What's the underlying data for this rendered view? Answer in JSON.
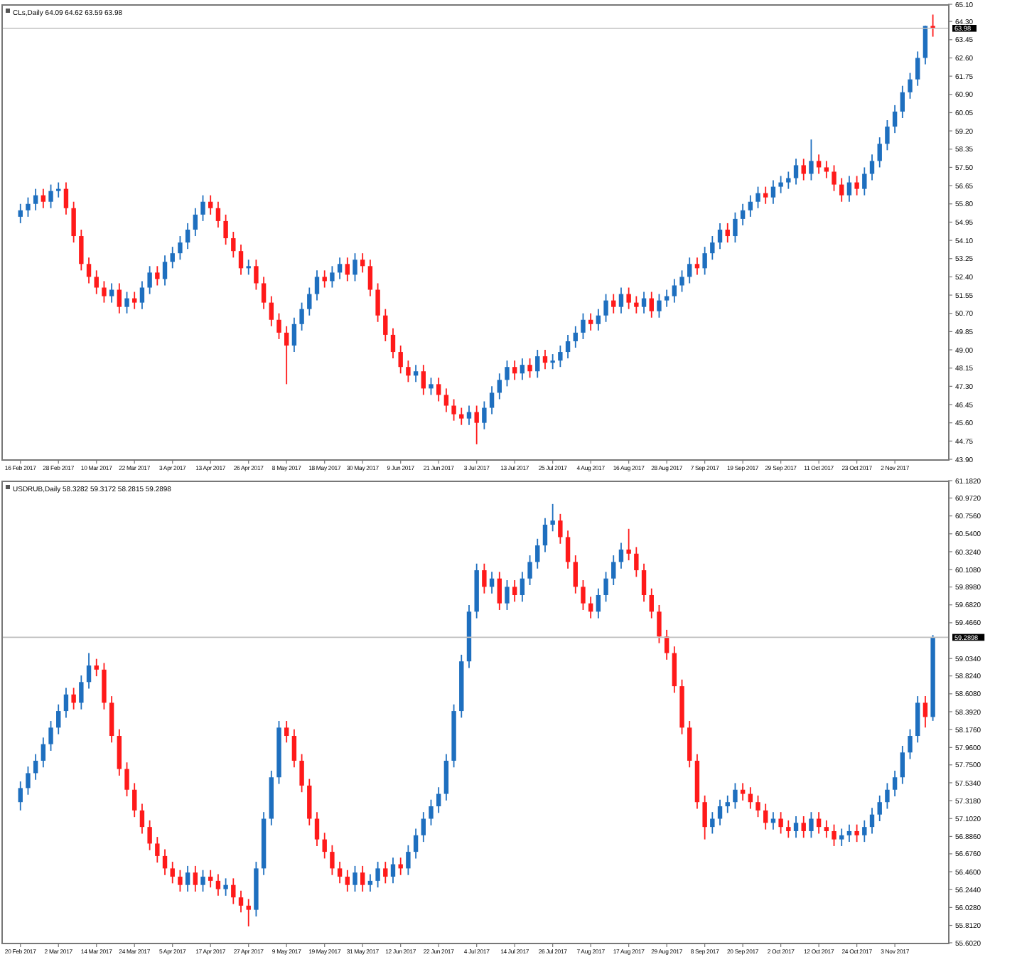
{
  "charts": [
    {
      "title": "CLs,Daily 64.09 64.62 63.59 63.98",
      "chart_data": {
        "type": "candlestick",
        "ylim": [
          43.9,
          65.1
        ],
        "ref_lines": [
          {
            "axis": "y",
            "value": 63.98,
            "label": "63.98"
          }
        ],
        "categories": [
          "16 Feb 2017",
          null,
          null,
          null,
          null,
          "28 Feb 2017",
          null,
          null,
          null,
          null,
          "10 Mar 2017",
          null,
          null,
          null,
          null,
          "22 Mar 2017",
          null,
          null,
          null,
          null,
          "3 Apr 2017",
          null,
          null,
          null,
          null,
          "13 Apr 2017",
          null,
          null,
          null,
          null,
          "26 Apr 2017",
          null,
          null,
          null,
          null,
          "8 May 2017",
          null,
          null,
          null,
          null,
          "18 May 2017",
          null,
          null,
          null,
          null,
          "30 May 2017",
          null,
          null,
          null,
          null,
          "9 Jun 2017",
          null,
          null,
          null,
          null,
          "21 Jun 2017",
          null,
          null,
          null,
          null,
          "3 Jul 2017",
          null,
          null,
          null,
          null,
          "13 Jul 2017",
          null,
          null,
          null,
          null,
          "25 Jul 2017",
          null,
          null,
          null,
          null,
          "4 Aug 2017",
          null,
          null,
          null,
          null,
          "16 Aug 2017",
          null,
          null,
          null,
          null,
          "28 Aug 2017",
          null,
          null,
          null,
          null,
          "7 Sep 2017",
          null,
          null,
          null,
          null,
          "19 Sep 2017",
          null,
          null,
          null,
          null,
          "29 Sep 2017",
          null,
          null,
          null,
          null,
          "11 Oct 2017",
          null,
          null,
          null,
          null,
          "23 Oct 2017",
          null,
          null,
          null,
          null,
          "2 Nov 2017",
          null,
          null,
          null,
          null,
          null
        ],
        "ohlc": [
          [
            55.2,
            55.8,
            54.9,
            55.5
          ],
          [
            55.5,
            56.1,
            55.2,
            55.8
          ],
          [
            55.8,
            56.5,
            55.5,
            56.2
          ],
          [
            56.2,
            56.5,
            55.6,
            55.9
          ],
          [
            55.9,
            56.7,
            55.6,
            56.4
          ],
          [
            56.4,
            56.8,
            56.1,
            56.5
          ],
          [
            56.5,
            56.8,
            55.3,
            55.6
          ],
          [
            55.6,
            55.9,
            54.0,
            54.3
          ],
          [
            54.3,
            54.6,
            52.7,
            53.0
          ],
          [
            53.0,
            53.3,
            52.1,
            52.4
          ],
          [
            52.4,
            52.7,
            51.6,
            51.9
          ],
          [
            51.9,
            52.2,
            51.2,
            51.5
          ],
          [
            51.5,
            52.1,
            51.2,
            51.8
          ],
          [
            51.8,
            52.1,
            50.7,
            51.0
          ],
          [
            51.0,
            51.7,
            50.7,
            51.4
          ],
          [
            51.4,
            51.7,
            50.9,
            51.2
          ],
          [
            51.2,
            52.2,
            50.9,
            51.9
          ],
          [
            51.9,
            52.9,
            51.6,
            52.6
          ],
          [
            52.6,
            52.9,
            52.0,
            52.3
          ],
          [
            52.3,
            53.4,
            52.0,
            53.1
          ],
          [
            53.1,
            53.8,
            52.8,
            53.5
          ],
          [
            53.5,
            54.3,
            53.2,
            54.0
          ],
          [
            54.0,
            54.9,
            53.7,
            54.6
          ],
          [
            54.6,
            55.6,
            54.3,
            55.3
          ],
          [
            55.3,
            56.2,
            55.0,
            55.9
          ],
          [
            55.9,
            56.2,
            55.3,
            55.6
          ],
          [
            55.6,
            55.9,
            54.7,
            55.0
          ],
          [
            55.0,
            55.3,
            53.9,
            54.2
          ],
          [
            54.2,
            54.5,
            53.3,
            53.6
          ],
          [
            53.6,
            53.9,
            52.5,
            52.8
          ],
          [
            52.8,
            53.2,
            52.5,
            52.9
          ],
          [
            52.9,
            53.2,
            51.8,
            52.1
          ],
          [
            52.1,
            52.4,
            50.9,
            51.2
          ],
          [
            51.2,
            51.5,
            50.1,
            50.4
          ],
          [
            50.4,
            50.7,
            49.5,
            49.8
          ],
          [
            49.8,
            50.1,
            47.4,
            49.2
          ],
          [
            49.2,
            50.5,
            48.9,
            50.2
          ],
          [
            50.2,
            51.2,
            49.9,
            50.9
          ],
          [
            50.9,
            51.9,
            50.6,
            51.6
          ],
          [
            51.6,
            52.7,
            51.3,
            52.4
          ],
          [
            52.4,
            52.7,
            51.9,
            52.2
          ],
          [
            52.2,
            52.9,
            51.9,
            52.6
          ],
          [
            52.6,
            53.3,
            52.3,
            53.0
          ],
          [
            53.0,
            53.3,
            52.2,
            52.5
          ],
          [
            52.5,
            53.5,
            52.2,
            53.2
          ],
          [
            53.2,
            53.5,
            52.6,
            52.9
          ],
          [
            52.9,
            53.2,
            51.5,
            51.8
          ],
          [
            51.8,
            52.1,
            50.3,
            50.6
          ],
          [
            50.6,
            50.9,
            49.4,
            49.7
          ],
          [
            49.7,
            50.0,
            48.6,
            48.9
          ],
          [
            48.9,
            49.2,
            47.9,
            48.2
          ],
          [
            48.2,
            48.5,
            47.5,
            47.8
          ],
          [
            47.8,
            48.3,
            47.5,
            48.0
          ],
          [
            48.0,
            48.3,
            46.9,
            47.2
          ],
          [
            47.2,
            47.7,
            46.9,
            47.4
          ],
          [
            47.4,
            47.7,
            46.6,
            46.9
          ],
          [
            46.9,
            47.2,
            46.1,
            46.4
          ],
          [
            46.4,
            46.7,
            45.7,
            46.0
          ],
          [
            46.0,
            46.3,
            45.5,
            45.8
          ],
          [
            45.8,
            46.4,
            45.5,
            46.1
          ],
          [
            46.1,
            46.4,
            44.6,
            45.6
          ],
          [
            45.6,
            46.6,
            45.3,
            46.3
          ],
          [
            46.3,
            47.3,
            46.0,
            47.0
          ],
          [
            47.0,
            47.9,
            46.7,
            47.6
          ],
          [
            47.6,
            48.5,
            47.3,
            48.2
          ],
          [
            48.2,
            48.5,
            47.6,
            47.9
          ],
          [
            47.9,
            48.6,
            47.6,
            48.3
          ],
          [
            48.3,
            48.6,
            47.7,
            48.0
          ],
          [
            48.0,
            49.0,
            47.7,
            48.7
          ],
          [
            48.7,
            49.0,
            48.1,
            48.4
          ],
          [
            48.4,
            48.8,
            48.1,
            48.5
          ],
          [
            48.5,
            49.2,
            48.2,
            48.9
          ],
          [
            48.9,
            49.7,
            48.6,
            49.4
          ],
          [
            49.4,
            50.1,
            49.1,
            49.8
          ],
          [
            49.8,
            50.7,
            49.5,
            50.4
          ],
          [
            50.4,
            50.7,
            49.9,
            50.2
          ],
          [
            50.2,
            50.9,
            49.9,
            50.6
          ],
          [
            50.6,
            51.6,
            50.3,
            51.3
          ],
          [
            51.3,
            51.6,
            50.7,
            51.0
          ],
          [
            51.0,
            51.9,
            50.7,
            51.6
          ],
          [
            51.6,
            51.9,
            50.9,
            51.2
          ],
          [
            51.2,
            51.5,
            50.7,
            51.0
          ],
          [
            51.0,
            51.7,
            50.7,
            51.4
          ],
          [
            51.4,
            51.7,
            50.5,
            50.8
          ],
          [
            50.8,
            51.6,
            50.5,
            51.3
          ],
          [
            51.3,
            51.8,
            51.0,
            51.5
          ],
          [
            51.5,
            52.3,
            51.2,
            52.0
          ],
          [
            52.0,
            52.7,
            51.7,
            52.4
          ],
          [
            52.4,
            53.3,
            52.1,
            53.0
          ],
          [
            53.0,
            53.3,
            52.5,
            52.8
          ],
          [
            52.8,
            53.8,
            52.5,
            53.5
          ],
          [
            53.5,
            54.3,
            53.2,
            54.0
          ],
          [
            54.0,
            54.9,
            53.7,
            54.6
          ],
          [
            54.6,
            54.9,
            54.0,
            54.3
          ],
          [
            54.3,
            55.4,
            54.0,
            55.1
          ],
          [
            55.1,
            55.8,
            54.8,
            55.5
          ],
          [
            55.5,
            56.2,
            55.2,
            55.9
          ],
          [
            55.9,
            56.6,
            55.6,
            56.3
          ],
          [
            56.3,
            56.6,
            55.8,
            56.1
          ],
          [
            56.1,
            56.9,
            55.8,
            56.6
          ],
          [
            56.6,
            57.1,
            56.3,
            56.8
          ],
          [
            56.8,
            57.3,
            56.5,
            57.0
          ],
          [
            57.0,
            57.9,
            56.7,
            57.6
          ],
          [
            57.6,
            57.9,
            56.9,
            57.2
          ],
          [
            57.2,
            58.8,
            56.9,
            57.8
          ],
          [
            57.8,
            58.1,
            57.2,
            57.5
          ],
          [
            57.5,
            57.8,
            57.0,
            57.3
          ],
          [
            57.3,
            57.6,
            56.4,
            56.7
          ],
          [
            56.7,
            57.0,
            55.9,
            56.2
          ],
          [
            56.2,
            57.1,
            55.9,
            56.8
          ],
          [
            56.8,
            57.1,
            56.2,
            56.5
          ],
          [
            56.5,
            57.5,
            56.2,
            57.2
          ],
          [
            57.2,
            58.1,
            56.9,
            57.8
          ],
          [
            57.8,
            58.9,
            57.5,
            58.6
          ],
          [
            58.6,
            59.7,
            58.3,
            59.4
          ],
          [
            59.4,
            60.4,
            59.1,
            60.1
          ],
          [
            60.1,
            61.3,
            59.8,
            61.0
          ],
          [
            61.0,
            61.9,
            60.7,
            61.6
          ],
          [
            61.6,
            62.9,
            61.3,
            62.6
          ],
          [
            62.6,
            64.1,
            62.3,
            64.09
          ],
          [
            64.09,
            64.62,
            63.59,
            63.98
          ]
        ],
        "yticks": [
          {
            "value": 65.1,
            "label": "65.10"
          },
          {
            "value": 64.3,
            "label": "64.30"
          },
          {
            "value": 63.45,
            "label": "63.45"
          },
          {
            "value": 62.6,
            "label": "62.60"
          },
          {
            "value": 61.75,
            "label": "61.75"
          },
          {
            "value": 60.9,
            "label": "60.90"
          },
          {
            "value": 60.05,
            "label": "60.05"
          },
          {
            "value": 59.2,
            "label": "59.20"
          },
          {
            "value": 58.35,
            "label": "58.35"
          },
          {
            "value": 57.5,
            "label": "57.50"
          },
          {
            "value": 56.65,
            "label": "56.65"
          },
          {
            "value": 55.8,
            "label": "55.80"
          },
          {
            "value": 54.95,
            "label": "54.95"
          },
          {
            "value": 54.1,
            "label": "54.10"
          },
          {
            "value": 53.25,
            "label": "53.25"
          },
          {
            "value": 52.4,
            "label": "52.40"
          },
          {
            "value": 51.55,
            "label": "51.55"
          },
          {
            "value": 50.7,
            "label": "50.70"
          },
          {
            "value": 49.85,
            "label": "49.85"
          },
          {
            "value": 49.0,
            "label": "49.00"
          },
          {
            "value": 48.15,
            "label": "48.15"
          },
          {
            "value": 47.3,
            "label": "47.30"
          },
          {
            "value": 46.45,
            "label": "46.45"
          },
          {
            "value": 45.6,
            "label": "45.60"
          },
          {
            "value": 44.75,
            "label": "44.75"
          },
          {
            "value": 43.9,
            "label": "43.90"
          }
        ]
      }
    },
    {
      "title": "USDRUB,Daily 58.3282 59.3172 58.2815 59.2898",
      "chart_data": {
        "type": "candlestick",
        "ylim": [
          55.602,
          61.182
        ],
        "ref_lines": [
          {
            "axis": "y",
            "value": 59.2898,
            "label": "59.2898"
          }
        ],
        "categories": [
          "20 Feb 2017",
          null,
          null,
          null,
          null,
          "2 Mar 2017",
          null,
          null,
          null,
          null,
          "14 Mar 2017",
          null,
          null,
          null,
          null,
          "24 Mar 2017",
          null,
          null,
          null,
          null,
          "5 Apr 2017",
          null,
          null,
          null,
          null,
          "17 Apr 2017",
          null,
          null,
          null,
          null,
          "27 Apr 2017",
          null,
          null,
          null,
          null,
          "9 May 2017",
          null,
          null,
          null,
          null,
          "19 May 2017",
          null,
          null,
          null,
          null,
          "31 May 2017",
          null,
          null,
          null,
          null,
          "12 Jun 2017",
          null,
          null,
          null,
          null,
          "22 Jun 2017",
          null,
          null,
          null,
          null,
          "4 Jul 2017",
          null,
          null,
          null,
          null,
          "14 Jul 2017",
          null,
          null,
          null,
          null,
          "26 Jul 2017",
          null,
          null,
          null,
          null,
          "7 Aug 2017",
          null,
          null,
          null,
          null,
          "17 Aug 2017",
          null,
          null,
          null,
          null,
          "29 Aug 2017",
          null,
          null,
          null,
          null,
          "8 Sep 2017",
          null,
          null,
          null,
          null,
          "20 Sep 2017",
          null,
          null,
          null,
          null,
          "2 Oct 2017",
          null,
          null,
          null,
          null,
          "12 Oct 2017",
          null,
          null,
          null,
          null,
          "24 Oct 2017",
          null,
          null,
          null,
          null,
          "3 Nov 2017",
          null,
          null,
          null,
          null,
          null
        ],
        "ohlc": [
          [
            57.3,
            57.55,
            57.2,
            57.47
          ],
          [
            57.47,
            57.73,
            57.39,
            57.65
          ],
          [
            57.65,
            57.88,
            57.57,
            57.8
          ],
          [
            57.8,
            58.08,
            57.72,
            58.0
          ],
          [
            58.0,
            58.28,
            57.92,
            58.2
          ],
          [
            58.2,
            58.48,
            58.12,
            58.4
          ],
          [
            58.4,
            58.68,
            58.32,
            58.6
          ],
          [
            58.6,
            58.68,
            58.42,
            58.5
          ],
          [
            58.5,
            58.83,
            58.42,
            58.75
          ],
          [
            58.75,
            59.1,
            58.67,
            58.95
          ],
          [
            58.95,
            59.03,
            58.82,
            58.9
          ],
          [
            58.9,
            58.98,
            58.42,
            58.5
          ],
          [
            58.5,
            58.58,
            58.02,
            58.1
          ],
          [
            58.1,
            58.18,
            57.62,
            57.7
          ],
          [
            57.7,
            57.78,
            57.37,
            57.45
          ],
          [
            57.45,
            57.53,
            57.12,
            57.2
          ],
          [
            57.2,
            57.28,
            56.92,
            57.0
          ],
          [
            57.0,
            57.08,
            56.72,
            56.8
          ],
          [
            56.8,
            56.88,
            56.57,
            56.65
          ],
          [
            56.65,
            56.73,
            56.42,
            56.5
          ],
          [
            56.5,
            56.58,
            56.32,
            56.4
          ],
          [
            56.4,
            56.48,
            56.22,
            56.3
          ],
          [
            56.3,
            56.53,
            56.22,
            56.45
          ],
          [
            56.45,
            56.53,
            56.22,
            56.3
          ],
          [
            56.3,
            56.48,
            56.22,
            56.4
          ],
          [
            56.4,
            56.48,
            56.27,
            56.35
          ],
          [
            56.35,
            56.43,
            56.17,
            56.25
          ],
          [
            56.25,
            56.38,
            56.17,
            56.3
          ],
          [
            56.3,
            56.38,
            56.07,
            56.15
          ],
          [
            56.15,
            56.23,
            55.97,
            56.05
          ],
          [
            56.05,
            56.13,
            55.8,
            56.0
          ],
          [
            56.0,
            56.58,
            55.92,
            56.5
          ],
          [
            56.5,
            57.18,
            56.42,
            57.1
          ],
          [
            57.1,
            57.68,
            57.02,
            57.6
          ],
          [
            57.6,
            58.28,
            57.52,
            58.2
          ],
          [
            58.2,
            58.28,
            58.02,
            58.1
          ],
          [
            58.1,
            58.18,
            57.72,
            57.8
          ],
          [
            57.8,
            57.88,
            57.42,
            57.5
          ],
          [
            57.5,
            57.58,
            57.02,
            57.1
          ],
          [
            57.1,
            57.18,
            56.77,
            56.85
          ],
          [
            56.85,
            56.93,
            56.62,
            56.7
          ],
          [
            56.7,
            56.78,
            56.42,
            56.5
          ],
          [
            56.5,
            56.58,
            56.32,
            56.4
          ],
          [
            56.4,
            56.48,
            56.22,
            56.3
          ],
          [
            56.3,
            56.53,
            56.22,
            56.45
          ],
          [
            56.45,
            56.53,
            56.22,
            56.3
          ],
          [
            56.3,
            56.43,
            56.22,
            56.35
          ],
          [
            56.35,
            56.58,
            56.27,
            56.5
          ],
          [
            56.5,
            56.58,
            56.32,
            56.4
          ],
          [
            56.4,
            56.63,
            56.32,
            56.55
          ],
          [
            56.55,
            56.63,
            56.42,
            56.5
          ],
          [
            56.5,
            56.78,
            56.42,
            56.7
          ],
          [
            56.7,
            56.98,
            56.62,
            56.9
          ],
          [
            56.9,
            57.18,
            56.82,
            57.1
          ],
          [
            57.1,
            57.33,
            57.02,
            57.25
          ],
          [
            57.25,
            57.48,
            57.17,
            57.4
          ],
          [
            57.4,
            57.88,
            57.32,
            57.8
          ],
          [
            57.8,
            58.48,
            57.72,
            58.4
          ],
          [
            58.4,
            59.08,
            58.32,
            59.0
          ],
          [
            59.0,
            59.68,
            58.92,
            59.6
          ],
          [
            59.6,
            60.18,
            59.52,
            60.1
          ],
          [
            60.1,
            60.18,
            59.82,
            59.9
          ],
          [
            59.9,
            60.08,
            59.82,
            60.0
          ],
          [
            60.0,
            60.08,
            59.62,
            59.7
          ],
          [
            59.7,
            59.98,
            59.62,
            59.9
          ],
          [
            59.9,
            59.98,
            59.72,
            59.8
          ],
          [
            59.8,
            60.08,
            59.72,
            60.0
          ],
          [
            60.0,
            60.28,
            59.92,
            60.2
          ],
          [
            60.2,
            60.48,
            60.12,
            60.4
          ],
          [
            60.4,
            60.73,
            60.32,
            60.65
          ],
          [
            60.65,
            60.9,
            60.57,
            60.7
          ],
          [
            60.7,
            60.78,
            60.42,
            60.5
          ],
          [
            60.5,
            60.58,
            60.12,
            60.2
          ],
          [
            60.2,
            60.28,
            59.82,
            59.9
          ],
          [
            59.9,
            59.98,
            59.62,
            59.7
          ],
          [
            59.7,
            59.78,
            59.52,
            59.6
          ],
          [
            59.6,
            59.88,
            59.52,
            59.8
          ],
          [
            59.8,
            60.08,
            59.72,
            60.0
          ],
          [
            60.0,
            60.28,
            59.92,
            60.2
          ],
          [
            60.2,
            60.43,
            60.12,
            60.35
          ],
          [
            60.35,
            60.6,
            60.22,
            60.3
          ],
          [
            60.3,
            60.38,
            60.02,
            60.1
          ],
          [
            60.1,
            60.18,
            59.72,
            59.8
          ],
          [
            59.8,
            59.88,
            59.52,
            59.6
          ],
          [
            59.6,
            59.68,
            59.22,
            59.3
          ],
          [
            59.3,
            59.38,
            59.02,
            59.1
          ],
          [
            59.1,
            59.18,
            58.62,
            58.7
          ],
          [
            58.7,
            58.78,
            58.12,
            58.2
          ],
          [
            58.2,
            58.28,
            57.72,
            57.8
          ],
          [
            57.8,
            57.88,
            57.22,
            57.3
          ],
          [
            57.3,
            57.38,
            56.85,
            57.0
          ],
          [
            57.0,
            57.18,
            56.92,
            57.1
          ],
          [
            57.1,
            57.33,
            57.02,
            57.25
          ],
          [
            57.25,
            57.38,
            57.17,
            57.3
          ],
          [
            57.3,
            57.53,
            57.22,
            57.45
          ],
          [
            57.45,
            57.53,
            57.32,
            57.4
          ],
          [
            57.4,
            57.48,
            57.22,
            57.3
          ],
          [
            57.3,
            57.38,
            57.12,
            57.2
          ],
          [
            57.2,
            57.28,
            56.97,
            57.05
          ],
          [
            57.05,
            57.18,
            56.97,
            57.1
          ],
          [
            57.1,
            57.18,
            56.92,
            57.0
          ],
          [
            57.0,
            57.08,
            56.87,
            56.95
          ],
          [
            56.95,
            57.13,
            56.87,
            57.05
          ],
          [
            57.05,
            57.13,
            56.87,
            56.95
          ],
          [
            56.95,
            57.18,
            56.87,
            57.1
          ],
          [
            57.1,
            57.18,
            56.92,
            57.0
          ],
          [
            57.0,
            57.08,
            56.87,
            56.95
          ],
          [
            56.95,
            57.03,
            56.77,
            56.85
          ],
          [
            56.85,
            56.98,
            56.77,
            56.9
          ],
          [
            56.9,
            57.03,
            56.82,
            56.95
          ],
          [
            56.95,
            57.03,
            56.82,
            56.9
          ],
          [
            56.9,
            57.08,
            56.82,
            57.0
          ],
          [
            57.0,
            57.23,
            56.92,
            57.15
          ],
          [
            57.15,
            57.38,
            57.07,
            57.3
          ],
          [
            57.3,
            57.53,
            57.22,
            57.45
          ],
          [
            57.45,
            57.68,
            57.37,
            57.6
          ],
          [
            57.6,
            57.98,
            57.52,
            57.9
          ],
          [
            57.9,
            58.18,
            57.82,
            58.1
          ],
          [
            58.1,
            58.58,
            58.02,
            58.5
          ],
          [
            58.5,
            58.58,
            58.2,
            58.3282
          ],
          [
            58.3282,
            59.3172,
            58.2815,
            59.2898
          ]
        ],
        "yticks": [
          {
            "value": 61.182,
            "label": "61.1820"
          },
          {
            "value": 60.972,
            "label": "60.9720"
          },
          {
            "value": 60.756,
            "label": "60.7560"
          },
          {
            "value": 60.54,
            "label": "60.5400"
          },
          {
            "value": 60.324,
            "label": "60.3240"
          },
          {
            "value": 60.108,
            "label": "60.1080"
          },
          {
            "value": 59.898,
            "label": "59.8980"
          },
          {
            "value": 59.682,
            "label": "59.6820"
          },
          {
            "value": 59.466,
            "label": "59.4660"
          },
          {
            "value": 59.034,
            "label": "59.0340"
          },
          {
            "value": 58.824,
            "label": "58.8240"
          },
          {
            "value": 58.608,
            "label": "58.6080"
          },
          {
            "value": 58.392,
            "label": "58.3920"
          },
          {
            "value": 58.176,
            "label": "58.1760"
          },
          {
            "value": 57.96,
            "label": "57.9600"
          },
          {
            "value": 57.75,
            "label": "57.7500"
          },
          {
            "value": 57.534,
            "label": "57.5340"
          },
          {
            "value": 57.318,
            "label": "57.3180"
          },
          {
            "value": 57.102,
            "label": "57.1020"
          },
          {
            "value": 56.886,
            "label": "56.8860"
          },
          {
            "value": 56.676,
            "label": "56.6760"
          },
          {
            "value": 56.46,
            "label": "56.4600"
          },
          {
            "value": 56.244,
            "label": "56.2440"
          },
          {
            "value": 56.028,
            "label": "56.0280"
          },
          {
            "value": 55.812,
            "label": "55.8120"
          },
          {
            "value": 55.602,
            "label": "55.6020"
          }
        ]
      }
    }
  ]
}
